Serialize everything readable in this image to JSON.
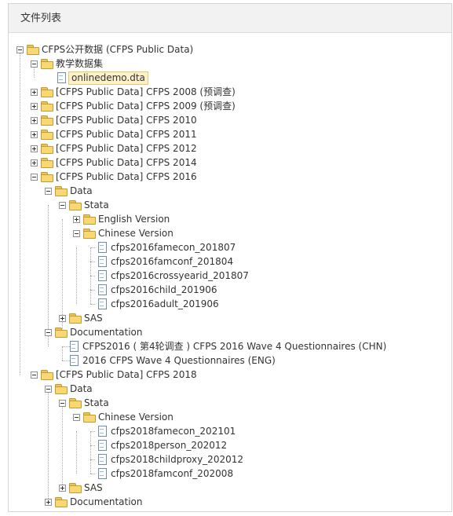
{
  "panel": {
    "title": "文件列表"
  },
  "tree": {
    "root": "CFPS公开数据 (CFPS Public Data)",
    "teaching": "教学数据集",
    "onlinedemo": "onlinedemo.dta",
    "y2008": "[CFPS Public Data] CFPS 2008 (预调查)",
    "y2009": "[CFPS Public Data] CFPS 2009 (预调查)",
    "y2010": "[CFPS Public Data] CFPS 2010",
    "y2011": "[CFPS Public Data] CFPS 2011",
    "y2012": "[CFPS Public Data] CFPS 2012",
    "y2014": "[CFPS Public Data] CFPS 2014",
    "y2016": "[CFPS Public Data] CFPS 2016",
    "data16": "Data",
    "stata16": "Stata",
    "english16": "English Version",
    "chinese16": "Chinese Version",
    "f16_1": "cfps2016famecon_201807",
    "f16_2": "cfps2016famconf_201804",
    "f16_3": "cfps2016crossyearid_201807",
    "f16_4": "cfps2016child_201906",
    "f16_5": "cfps2016adult_201906",
    "sas16": "SAS",
    "docs16": "Documentation",
    "doc16_1": "CFPS2016 ( 第4轮调查 ) CFPS 2016 Wave 4 Questionnaires (CHN)",
    "doc16_2": "2016 CFPS Wave 4 Questionnaires (ENG)",
    "y2018": "[CFPS Public Data] CFPS 2018",
    "data18": "Data",
    "stata18": "Stata",
    "chinese18": "Chinese Version",
    "f18_1": "cfps2018famecon_202101",
    "f18_2": "cfps2018person_202012",
    "f18_3": "cfps2018childproxy_202012",
    "f18_4": "cfps2018famconf_202008",
    "sas18": "SAS",
    "docs18": "Documentation"
  }
}
